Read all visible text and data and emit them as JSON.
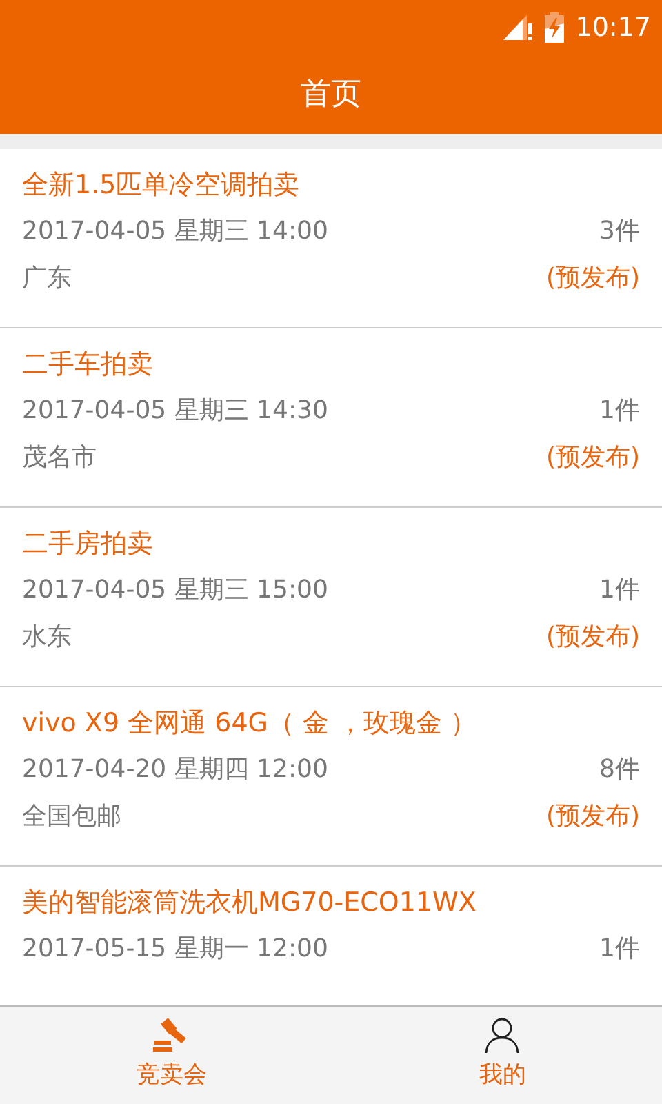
{
  "status_bar": {
    "time": "10:17"
  },
  "header": {
    "title": "首页"
  },
  "auctions": [
    {
      "title": "全新1.5匹单冷空调拍卖",
      "date": "2017-04-05 星期三 14:00",
      "count": "3件",
      "location": "广东",
      "status": "(预发布)"
    },
    {
      "title": "二手车拍卖",
      "date": "2017-04-05 星期三 14:30",
      "count": "1件",
      "location": "茂名市",
      "status": "(预发布)"
    },
    {
      "title": "二手房拍卖",
      "date": "2017-04-05 星期三 15:00",
      "count": "1件",
      "location": "水东",
      "status": "(预发布)"
    },
    {
      "title": "vivo X9 全网通 64G（ 金 ，玫瑰金 ）",
      "date": "2017-04-20 星期四 12:00",
      "count": "8件",
      "location": "全国包邮",
      "status": "(预发布)"
    },
    {
      "title": "美的智能滚筒洗衣机MG70-ECO11WX",
      "date": "2017-05-15 星期一 12:00",
      "count": "1件"
    }
  ],
  "tabs": [
    {
      "kind": "gavel",
      "label": "竞卖会",
      "selected": true
    },
    {
      "kind": "person",
      "label": "我的",
      "selected": false
    }
  ]
}
